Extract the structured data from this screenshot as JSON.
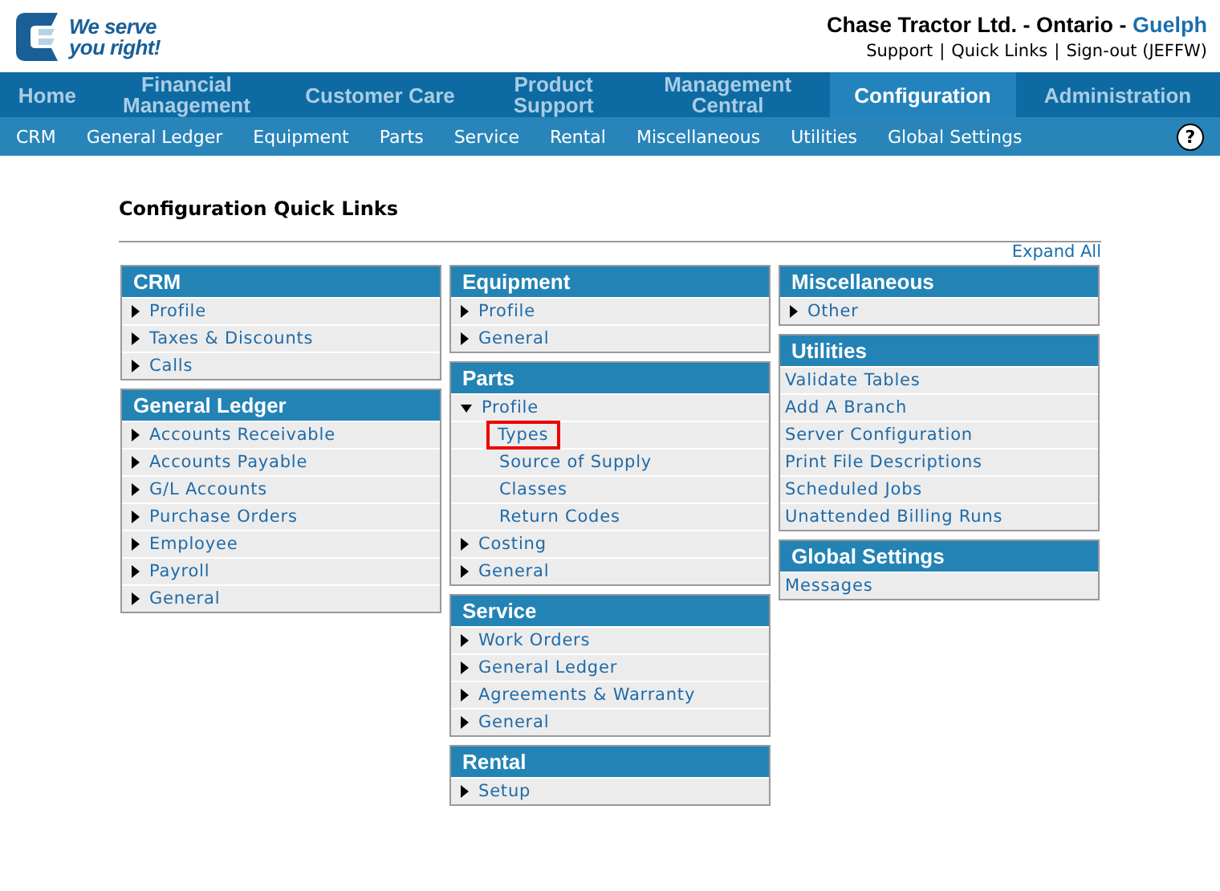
{
  "logo": {
    "slogan_1": "We serve",
    "slogan_2": "you right!"
  },
  "header": {
    "company": "Chase Tractor Ltd. - Ontario - ",
    "location": "Guelph",
    "links": [
      "Support",
      "Quick Links",
      "Sign-out (JEFFW)"
    ],
    "separator": "|"
  },
  "main_nav": [
    {
      "label": "Home",
      "selected": false
    },
    {
      "label": "Financial Management",
      "selected": false
    },
    {
      "label": "Customer Care",
      "selected": false
    },
    {
      "label": "Product Support",
      "selected": false
    },
    {
      "label": "Management Central",
      "selected": false
    },
    {
      "label": "Configuration",
      "selected": true
    },
    {
      "label": "Administration",
      "selected": false
    }
  ],
  "sub_nav": [
    "CRM",
    "General Ledger",
    "Equipment",
    "Parts",
    "Service",
    "Rental",
    "Miscellaneous",
    "Utilities",
    "Global Settings"
  ],
  "help": "?",
  "page_title": "Configuration Quick Links",
  "expand_all": "Expand All",
  "columns": [
    [
      {
        "title": "CRM",
        "items": [
          {
            "label": "Profile",
            "kind": "node",
            "expanded": false
          },
          {
            "label": "Taxes & Discounts",
            "kind": "node",
            "expanded": false
          },
          {
            "label": "Calls",
            "kind": "node",
            "expanded": false
          }
        ]
      },
      {
        "title": "General Ledger",
        "items": [
          {
            "label": "Accounts Receivable",
            "kind": "node",
            "expanded": false
          },
          {
            "label": "Accounts Payable",
            "kind": "node",
            "expanded": false
          },
          {
            "label": "G/L Accounts",
            "kind": "node",
            "expanded": false
          },
          {
            "label": "Purchase Orders",
            "kind": "node",
            "expanded": false
          },
          {
            "label": "Employee",
            "kind": "node",
            "expanded": false
          },
          {
            "label": "Payroll",
            "kind": "node",
            "expanded": false
          },
          {
            "label": "General",
            "kind": "node",
            "expanded": false
          }
        ]
      }
    ],
    [
      {
        "title": "Equipment",
        "items": [
          {
            "label": "Profile",
            "kind": "node",
            "expanded": false
          },
          {
            "label": "General",
            "kind": "node",
            "expanded": false
          }
        ]
      },
      {
        "title": "Parts",
        "items": [
          {
            "label": "Profile",
            "kind": "node",
            "expanded": true,
            "children": [
              {
                "label": "Types",
                "highlighted": true
              },
              {
                "label": "Source of Supply",
                "highlighted": false
              },
              {
                "label": "Classes",
                "highlighted": false
              },
              {
                "label": "Return Codes",
                "highlighted": false
              }
            ]
          },
          {
            "label": "Costing",
            "kind": "node",
            "expanded": false
          },
          {
            "label": "General",
            "kind": "node",
            "expanded": false
          }
        ]
      },
      {
        "title": "Service",
        "items": [
          {
            "label": "Work Orders",
            "kind": "node",
            "expanded": false
          },
          {
            "label": "General Ledger",
            "kind": "node",
            "expanded": false
          },
          {
            "label": "Agreements & Warranty",
            "kind": "node",
            "expanded": false
          },
          {
            "label": "General",
            "kind": "node",
            "expanded": false
          }
        ]
      },
      {
        "title": "Rental",
        "items": [
          {
            "label": "Setup",
            "kind": "node",
            "expanded": false
          }
        ]
      }
    ],
    [
      {
        "title": "Miscellaneous",
        "items": [
          {
            "label": "Other",
            "kind": "node",
            "expanded": false
          }
        ]
      },
      {
        "title": "Utilities",
        "items": [
          {
            "label": "Validate Tables",
            "kind": "link"
          },
          {
            "label": "Add A Branch",
            "kind": "link"
          },
          {
            "label": "Server Configuration",
            "kind": "link"
          },
          {
            "label": "Print File Descriptions",
            "kind": "link"
          },
          {
            "label": "Scheduled Jobs",
            "kind": "link"
          },
          {
            "label": "Unattended Billing Runs",
            "kind": "link"
          }
        ]
      },
      {
        "title": "Global Settings",
        "items": [
          {
            "label": "Messages",
            "kind": "link"
          }
        ]
      }
    ]
  ]
}
